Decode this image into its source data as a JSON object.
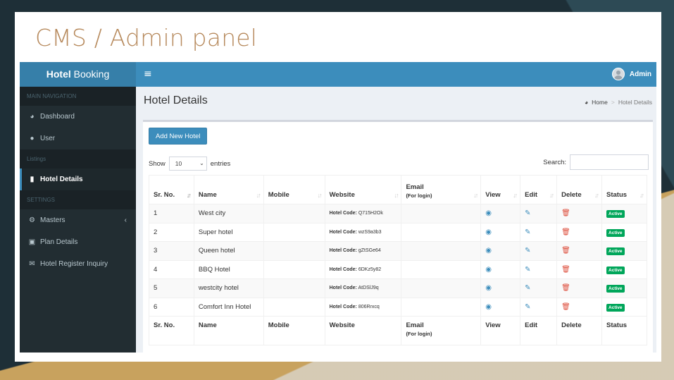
{
  "slide": {
    "title": "CMS / Admin panel"
  },
  "header": {
    "brand_bold": "Hotel",
    "brand_rest": " Booking",
    "menu_icon": "hamburger-icon",
    "user_name": "Admin"
  },
  "sidebar": {
    "sections": [
      {
        "header": "MAIN NAVIGATION"
      },
      {
        "header": "Listings"
      },
      {
        "header": "SETTINGS"
      }
    ],
    "items": [
      {
        "label": "Dashboard",
        "icon": "dashboard-icon"
      },
      {
        "label": "User",
        "icon": "user-icon"
      },
      {
        "label": "Hotel Details",
        "icon": "building-icon"
      },
      {
        "label": "Masters",
        "icon": "gears-icon"
      },
      {
        "label": "Plan Details",
        "icon": "money-icon"
      },
      {
        "label": "Hotel Register Inquiry",
        "icon": "envelope-icon"
      }
    ]
  },
  "content": {
    "page_title": "Hotel Details",
    "breadcrumb": {
      "home": "Home",
      "current": "Hotel Details"
    },
    "add_button": "Add New Hotel",
    "show_label": "Show",
    "entries_value": "10",
    "entries_label": "entries",
    "search_label": "Search:",
    "search_value": "",
    "table": {
      "columns": [
        "Sr. No.",
        "Name",
        "Mobile",
        "Website",
        "Email",
        "View",
        "Edit",
        "Delete",
        "Status"
      ],
      "email_sub": "(For login)",
      "code_label": "Hotel Code:",
      "status_label": "Active",
      "rows": [
        {
          "sr": "1",
          "name": "West city",
          "code": "Q715H2Ok"
        },
        {
          "sr": "2",
          "name": "Super hotel",
          "code": "wzS9a3b3"
        },
        {
          "sr": "3",
          "name": "Queen hotel",
          "code": "gZtSGe64"
        },
        {
          "sr": "4",
          "name": "BBQ Hotel",
          "code": "6DKz5y82"
        },
        {
          "sr": "5",
          "name": "westcity hotel",
          "code": "AtDSlJ9q"
        },
        {
          "sr": "6",
          "name": "Comfort Inn Hotel",
          "code": "806Rrxcq"
        }
      ]
    }
  },
  "colors": {
    "primary": "#3c8dbc",
    "sidebar": "#222d32",
    "success": "#00a65a",
    "danger": "#dd4b39",
    "slide_title": "#b78a5d"
  }
}
